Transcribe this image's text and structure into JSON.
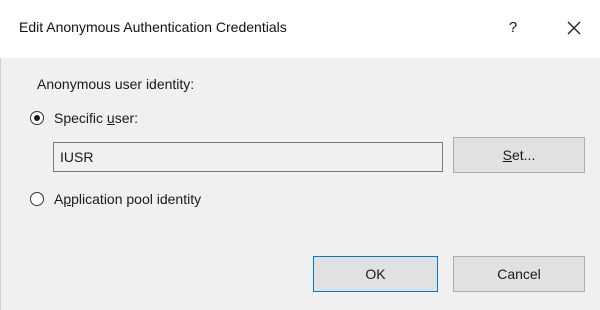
{
  "window": {
    "title": "Edit Anonymous Authentication Credentials",
    "help_glyph": "?",
    "close_icon": "close-icon"
  },
  "identity": {
    "section_label": "Anonymous user identity:",
    "specific_user": {
      "label_prefix": "Specific ",
      "label_accel": "u",
      "label_suffix": "ser:",
      "selected": true,
      "value": "IUSR"
    },
    "set_button": {
      "label_accel": "S",
      "label_suffix": "et..."
    },
    "app_pool": {
      "label_prefix": "A",
      "label_accel": "p",
      "label_suffix": "plication pool identity",
      "selected": false
    }
  },
  "footer": {
    "ok_label": "OK",
    "cancel_label": "Cancel"
  },
  "colors": {
    "dialog_bg": "#f0f0f0",
    "titlebar_bg": "#ffffff",
    "button_bg": "#e1e1e1",
    "default_button_border": "#0078d7"
  }
}
